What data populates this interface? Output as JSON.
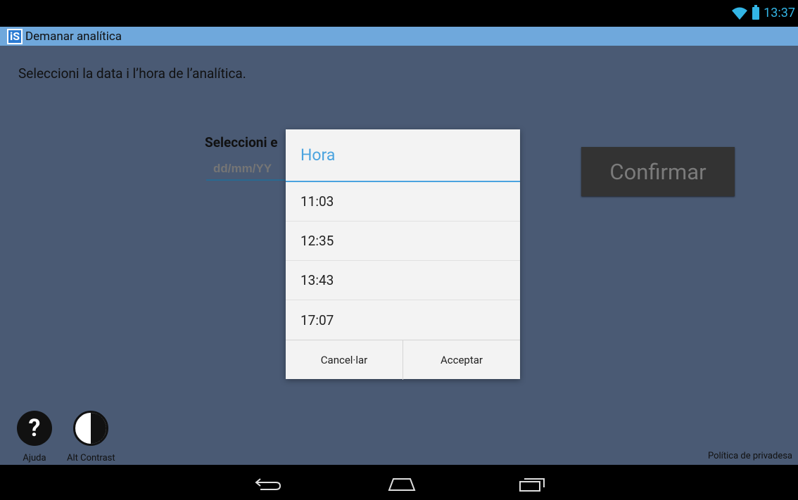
{
  "status": {
    "time": "13:37",
    "icons": [
      "wifi-icon",
      "battery-icon"
    ],
    "accent": "#33b5e5"
  },
  "app": {
    "title": "Demanar analítica",
    "icon_glyph": "iS"
  },
  "main": {
    "instruction": "Seleccioni la data i l’hora de l’analítica.",
    "select_label": "Seleccioni e",
    "date_placeholder": "dd/mm/YY",
    "confirm_label": "Confirmar"
  },
  "footer": {
    "help_label": "Ajuda",
    "help_glyph": "?",
    "contrast_label": "Alt Contrast",
    "privacy_label": "Política de privadesa"
  },
  "dialog": {
    "title": "Hora",
    "items": [
      "11:03",
      "12:35",
      "13:43",
      "17:07"
    ],
    "cancel_label": "Cancel·lar",
    "accept_label": "Acceptar"
  },
  "nav": {
    "icons": [
      "back-icon",
      "home-icon",
      "recents-icon"
    ]
  },
  "colors": {
    "background": "#4a5a74",
    "title_bar": "#6fa8dc",
    "dialog_accent": "#4aa3df"
  }
}
